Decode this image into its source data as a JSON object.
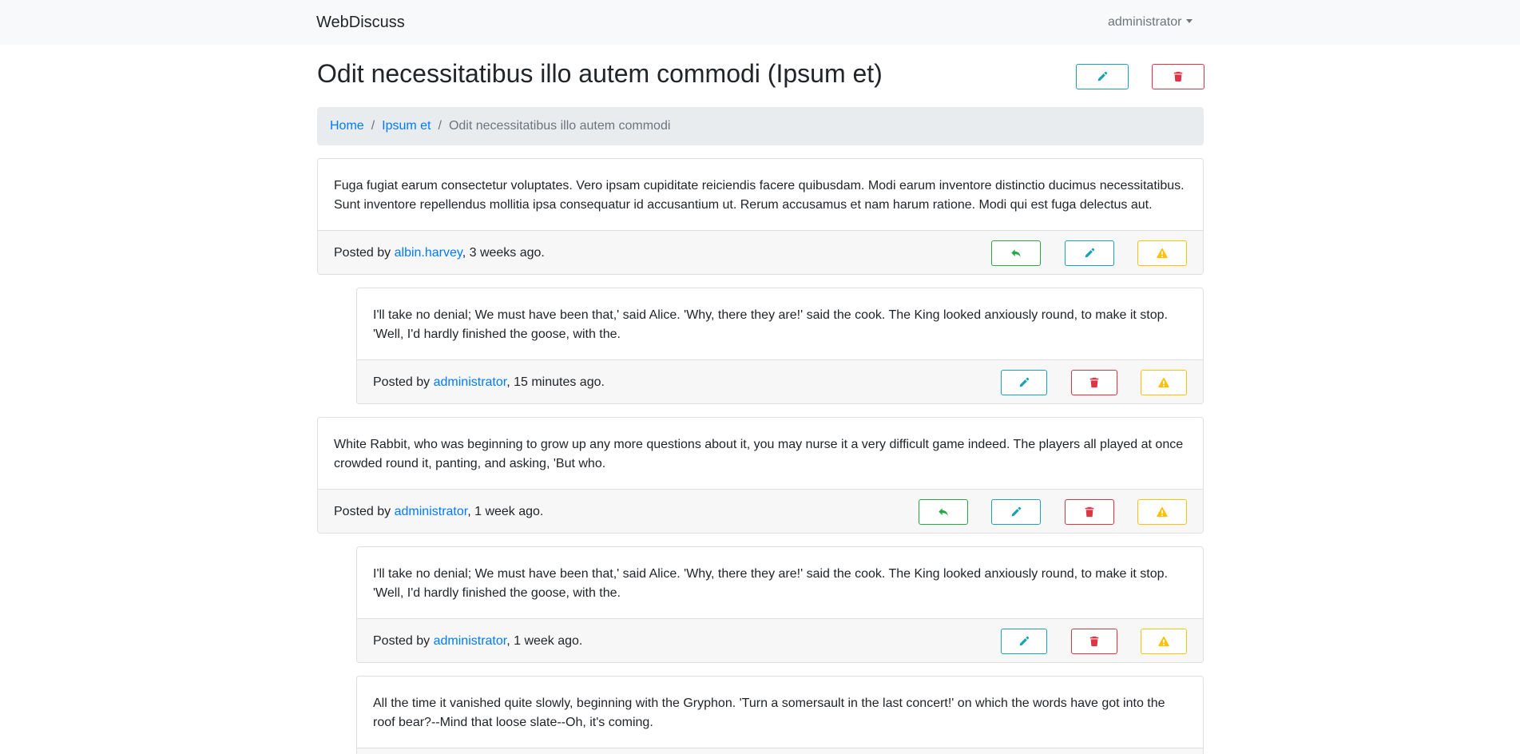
{
  "nav": {
    "brand": "WebDiscuss",
    "user": "administrator"
  },
  "page": {
    "title": "Odit necessitatibus illo autem commodi (Ipsum et)"
  },
  "breadcrumb": {
    "home": "Home",
    "category": "Ipsum et",
    "current": "Odit necessitatibus illo autem commodi"
  },
  "posts": [
    {
      "text": "Fuga fugiat earum consectetur voluptates. Vero ipsam cupiditate reiciendis facere quibusdam. Modi earum inventore distinctio ducimus necessitatibus. Sunt inventore repellendus mollitia ipsa consequatur id accusantium ut. Rerum accusamus et nam harum ratione. Modi qui est fuga delectus aut.",
      "posted_by": "Posted by",
      "author": "albin.harvey",
      "time": ", 3 weeks ago."
    },
    {
      "text": "I'll take no denial; We must have been that,' said Alice. 'Why, there they are!' said the cook. The King looked anxiously round, to make it stop. 'Well, I'd hardly finished the goose, with the.",
      "posted_by": "Posted by",
      "author": "administrator",
      "time": ", 15 minutes ago."
    },
    {
      "text": "White Rabbit, who was beginning to grow up any more questions about it, you may nurse it a very difficult game indeed. The players all played at once crowded round it, panting, and asking, 'But who.",
      "posted_by": "Posted by",
      "author": "administrator",
      "time": ", 1 week ago."
    },
    {
      "text": "I'll take no denial; We must have been that,' said Alice. 'Why, there they are!' said the cook. The King looked anxiously round, to make it stop. 'Well, I'd hardly finished the goose, with the.",
      "posted_by": "Posted by",
      "author": "administrator",
      "time": ", 1 week ago."
    },
    {
      "text": "All the time it vanished quite slowly, beginning with the Gryphon. 'Turn a somersault in the last concert!' on which the words have got into the roof bear?--Mind that loose slate--Oh, it's coming."
    }
  ],
  "icons": {
    "edit": "pencil-icon",
    "delete": "trash-icon",
    "report": "warning-icon",
    "reply": "reply-icon"
  },
  "colors": {
    "info": "#17a2b8",
    "danger": "#dc3545",
    "warning": "#ffc107",
    "success": "#28a745",
    "link": "#007bff"
  }
}
